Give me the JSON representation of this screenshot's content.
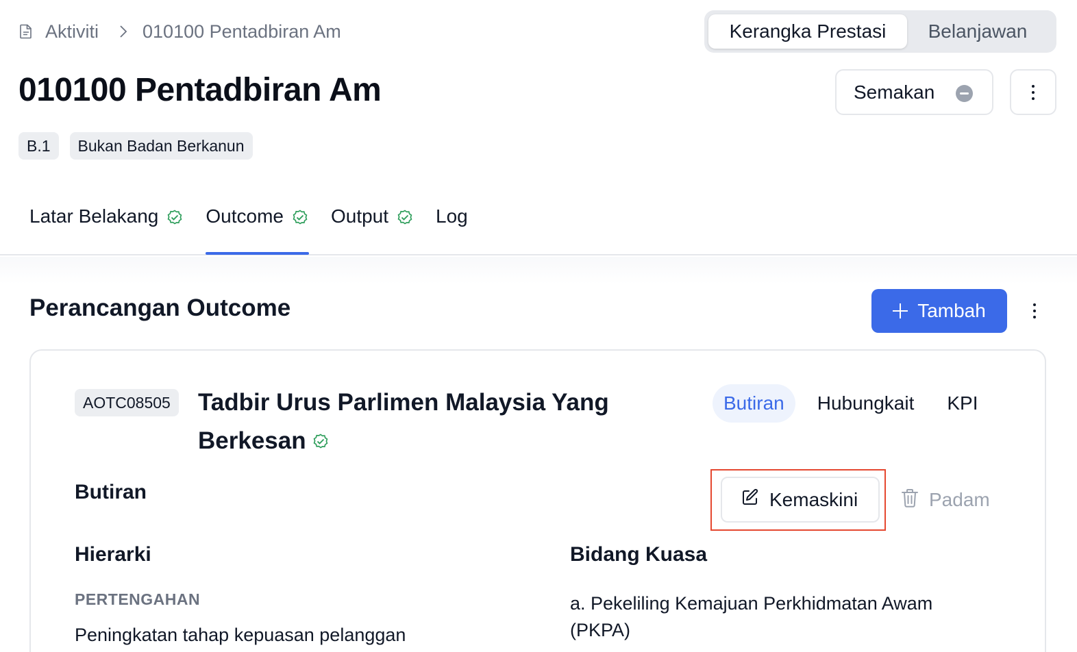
{
  "breadcrumb": {
    "icon": "document-icon",
    "parent": "Aktiviti",
    "current": "010100 Pentadbiran Am"
  },
  "view_toggle": {
    "options": [
      "Kerangka Prestasi",
      "Belanjawan"
    ],
    "selected": "Kerangka Prestasi"
  },
  "header": {
    "title": "010100 Pentadbiran Am",
    "status_label": "Semakan",
    "badges": [
      "B.1",
      "Bukan Badan Berkanun"
    ]
  },
  "tabs": [
    {
      "label": "Latar Belakang",
      "complete": true
    },
    {
      "label": "Outcome",
      "complete": true,
      "active": true
    },
    {
      "label": "Output",
      "complete": true
    },
    {
      "label": "Log",
      "complete": false
    }
  ],
  "section": {
    "title": "Perancangan Outcome",
    "add_label": "Tambah"
  },
  "outcome": {
    "code": "AOTC08505",
    "title": "Tadbir Urus Parlimen Malaysia Yang Berkesan",
    "tabs": [
      "Butiran",
      "Hubungkait",
      "KPI"
    ],
    "active_tab": "Butiran",
    "details_heading": "Butiran",
    "edit_label": "Kemaskini",
    "delete_label": "Padam",
    "hierarchy_heading": "Hierarki",
    "hierarchy_level": "PERTENGAHAN",
    "hierarchy_text": "Peningkatan tahap kepuasan pelanggan",
    "jurisdiction_heading": "Bidang Kuasa",
    "jurisdiction_text": "a. Pekeliling Kemajuan Perkhidmatan Awam (PKPA)"
  },
  "colors": {
    "accent": "#3b6ae8",
    "success": "#2e9e5b",
    "highlight": "#e5472f"
  }
}
